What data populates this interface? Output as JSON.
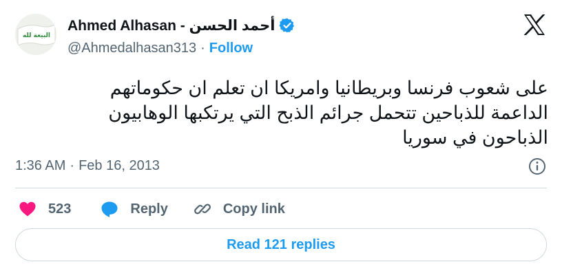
{
  "author": {
    "display_name": "Ahmed Alhasan - أحمد الحسن",
    "handle": "@Ahmedalhasan313",
    "separator": "·",
    "follow_label": "Follow",
    "avatar_banner_text": "البيعة لله",
    "verified_icon": "verified-badge-icon",
    "accent_color": "#1d9bf0"
  },
  "brand": {
    "logo_icon": "x-logo-icon"
  },
  "tweet": {
    "text": "على شعوب فرنسا وبريطانيا وامريكا ان تعلم ان حكوماتهم\nالداعمة للذباحين تتحمل جرائم الذبح التي يرتكبها الوهابيون\nالذباحون في سوريا",
    "time": "1:36 AM",
    "separator": "·",
    "date": "Feb 16, 2013",
    "info_icon": "info-icon"
  },
  "actions": {
    "like_icon": "heart-icon",
    "like_count": "523",
    "like_color": "#f91880",
    "reply_icon": "speech-bubble-icon",
    "reply_label": "Reply",
    "copy_icon": "link-icon",
    "copy_label": "Copy link"
  },
  "replies_button": {
    "label": "Read 121 replies"
  }
}
